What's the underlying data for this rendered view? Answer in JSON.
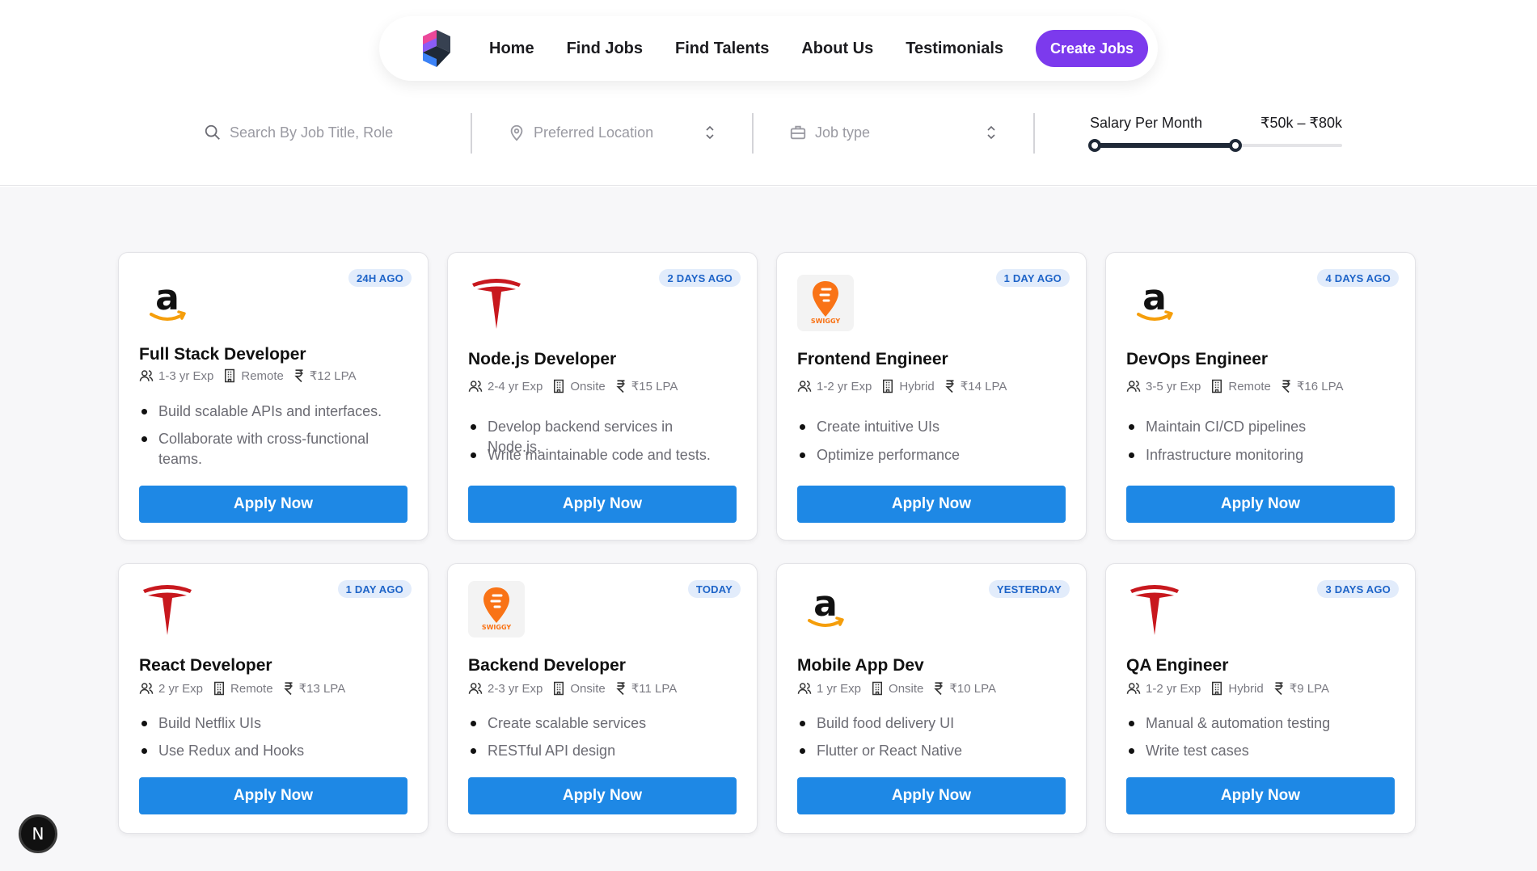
{
  "nav": {
    "links": [
      "Home",
      "Find Jobs",
      "Find Talents",
      "About Us",
      "Testimonials"
    ],
    "create_label": "Create Jobs",
    "logo_icon": "cube-logo-icon"
  },
  "filters": {
    "search_placeholder": "Search By Job Title, Role",
    "location_placeholder": "Preferred Location",
    "jobtype_placeholder": "Job type",
    "salary_label": "Salary Per Month",
    "salary_range": "₹50k – ₹80k",
    "salary_slider": {
      "min_fraction": 0.0,
      "max_fraction": 0.57
    }
  },
  "jobs": [
    {
      "company_icon": "amazon-logo-icon",
      "badge": "24H AGO",
      "title": "Full Stack Developer",
      "exp": "1-3 yr Exp",
      "mode": "Remote",
      "salary": "₹12 LPA",
      "points": [
        "Build scalable APIs and interfaces.",
        "Collaborate with cross-functional teams."
      ],
      "apply": "Apply Now"
    },
    {
      "company_icon": "tesla-logo-icon",
      "badge": "2 DAYS AGO",
      "title": "Node.js Developer",
      "exp": "2-4 yr Exp",
      "mode": "Onsite",
      "salary": "₹15 LPA",
      "points": [
        "Develop backend services in Node.js.",
        "Write maintainable code and tests."
      ],
      "apply": "Apply Now"
    },
    {
      "company_icon": "swiggy-logo-icon",
      "badge": "1 DAY AGO",
      "title": "Frontend Engineer",
      "exp": "1-2 yr Exp",
      "mode": "Hybrid",
      "salary": "₹14 LPA",
      "points": [
        "Create intuitive UIs",
        "Optimize performance"
      ],
      "apply": "Apply Now"
    },
    {
      "company_icon": "amazon-logo-icon",
      "badge": "4 DAYS AGO",
      "title": "DevOps Engineer",
      "exp": "3-5 yr Exp",
      "mode": "Remote",
      "salary": "₹16 LPA",
      "points": [
        "Maintain CI/CD pipelines",
        "Infrastructure monitoring"
      ],
      "apply": "Apply Now"
    },
    {
      "company_icon": "tesla-logo-icon",
      "badge": "1 DAY AGO",
      "title": "React Developer",
      "exp": "2 yr Exp",
      "mode": "Remote",
      "salary": "₹13 LPA",
      "points": [
        "Build Netflix UIs",
        "Use Redux and Hooks"
      ],
      "apply": "Apply Now"
    },
    {
      "company_icon": "swiggy-logo-icon",
      "badge": "TODAY",
      "title": "Backend Developer",
      "exp": "2-3 yr Exp",
      "mode": "Onsite",
      "salary": "₹11 LPA",
      "points": [
        "Create scalable services",
        "RESTful API design"
      ],
      "apply": "Apply Now"
    },
    {
      "company_icon": "amazon-logo-icon",
      "badge": "YESTERDAY",
      "title": "Mobile App Dev",
      "exp": "1 yr Exp",
      "mode": "Onsite",
      "salary": "₹10 LPA",
      "points": [
        "Build food delivery UI",
        "Flutter or React Native"
      ],
      "apply": "Apply Now"
    },
    {
      "company_icon": "tesla-logo-icon",
      "badge": "3 DAYS AGO",
      "title": "QA Engineer",
      "exp": "1-2 yr Exp",
      "mode": "Hybrid",
      "salary": "₹9 LPA",
      "points": [
        "Manual & automation testing",
        "Write test cases"
      ],
      "apply": "Apply Now"
    }
  ],
  "swiggy_logo_text": "SWIGGY",
  "next_badge": "N",
  "colors": {
    "accent": "#7c3aed",
    "apply": "#1e88e5",
    "badge_bg": "#e2ecfb",
    "badge_text": "#1e64c8"
  }
}
